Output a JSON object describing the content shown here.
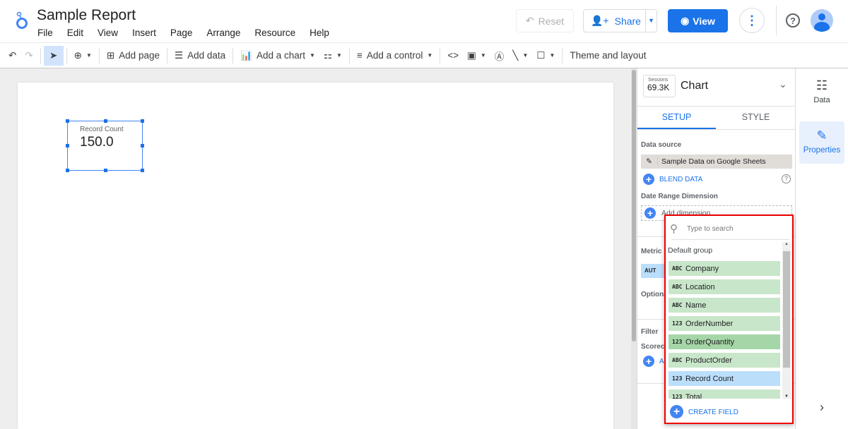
{
  "app": {
    "title": "Sample Report",
    "menu": [
      "File",
      "Edit",
      "View",
      "Insert",
      "Page",
      "Arrange",
      "Resource",
      "Help"
    ],
    "reset": "Reset",
    "share": "Share",
    "view": "View"
  },
  "toolbar": {
    "add_page": "Add page",
    "add_data": "Add data",
    "add_chart": "Add a chart",
    "add_control": "Add a control",
    "theme": "Theme and layout"
  },
  "scorecard": {
    "label": "Record Count",
    "value": "150.0"
  },
  "panel": {
    "chip_label": "Sessions",
    "chip_value": "69.3K",
    "title": "Chart",
    "tabs": [
      "SETUP",
      "STYLE"
    ],
    "data_source_label": "Data source",
    "data_source": "Sample Data on Google Sheets",
    "blend": "BLEND DATA",
    "date_range_label": "Date Range Dimension",
    "add_dimension": "Add dimension",
    "metric_label": "Metric",
    "metric_chip": "AUT",
    "optional_label": "Optiona",
    "filter_label": "Filter",
    "scorecard_label": "Scoreca",
    "add_short": "A"
  },
  "dropdown": {
    "placeholder": "Type to search",
    "group": "Default group",
    "fields": [
      {
        "type": "ABC",
        "name": "Company"
      },
      {
        "type": "ABC",
        "name": "Location"
      },
      {
        "type": "ABC",
        "name": "Name"
      },
      {
        "type": "123",
        "name": "OrderNumber"
      },
      {
        "type": "123",
        "name": "OrderQuantity"
      },
      {
        "type": "ABC",
        "name": "ProductOrder"
      },
      {
        "type": "123",
        "name": "Record Count"
      },
      {
        "type": "123",
        "name": "Total"
      }
    ],
    "create": "CREATE FIELD"
  },
  "rail": {
    "data": "Data",
    "properties": "Properties"
  },
  "colors": {
    "accent": "#1a73e8",
    "dimension": "#c8e6c9",
    "metric": "#bbdefb",
    "highlight": "#a5d6a7",
    "outline": "#e00000"
  }
}
